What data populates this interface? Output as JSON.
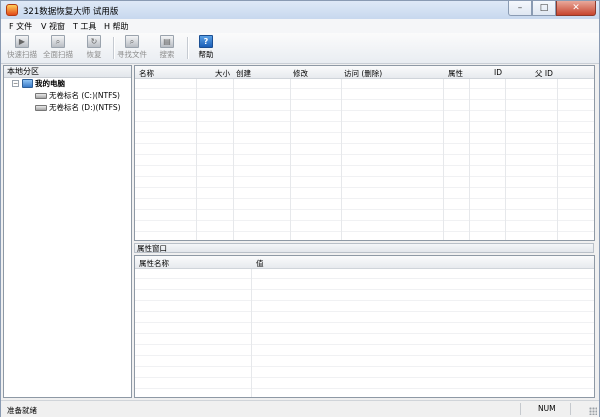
{
  "window": {
    "title": "321数据恢复大师 试用版"
  },
  "menu": [
    "F 文件",
    "V 视窗",
    "T 工具",
    "H 帮助"
  ],
  "toolbar": {
    "quick_scan": "快速扫描",
    "full_scan": "全面扫描",
    "recover": "恢复",
    "find_file": "寻找文件",
    "search": "搜索",
    "help": "帮助"
  },
  "left_pane": {
    "header": "本地分区",
    "root": {
      "label": "我的电脑",
      "expander": "−"
    },
    "drives": [
      {
        "label": "无卷标名 (C:)(NTFS)"
      },
      {
        "label": "无卷标名 (D:)(NTFS)"
      }
    ]
  },
  "file_list": {
    "columns": [
      "名称",
      "大小",
      "创建",
      "修改",
      "访问 (删除)",
      "属性",
      "ID",
      "父 ID"
    ]
  },
  "properties": {
    "title": "属性窗口",
    "columns": [
      "属性名称",
      "值"
    ]
  },
  "status": {
    "text": "准备就绪",
    "num": "NUM"
  },
  "colors": {
    "titlebar": "#c7d8ee",
    "help_icon": "#1c5fb8",
    "close_button": "#c7452f"
  }
}
